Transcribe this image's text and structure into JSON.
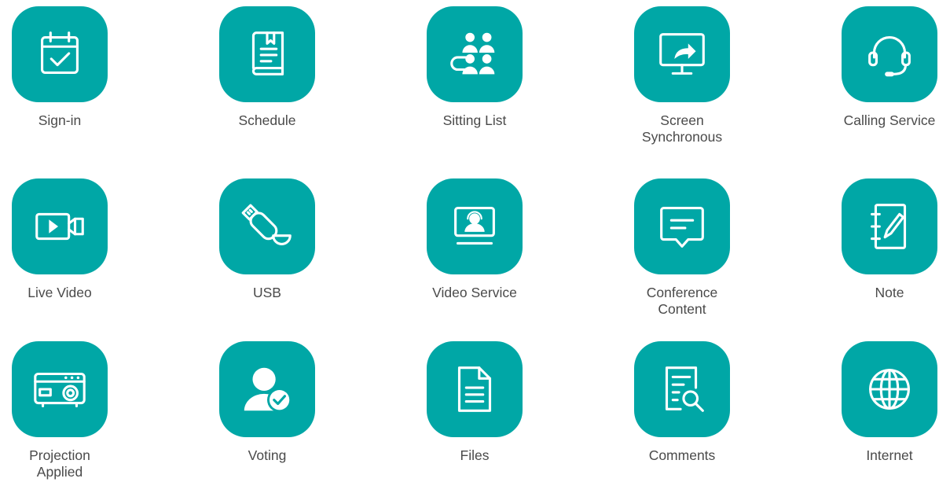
{
  "apps": [
    {
      "label": "Sign-in",
      "icon": "calendar-check-icon"
    },
    {
      "label": "Schedule",
      "icon": "book-icon"
    },
    {
      "label": "Sitting List",
      "icon": "seating-people-icon"
    },
    {
      "label_lines": [
        "Screen",
        "Synchronous"
      ],
      "icon": "monitor-share-icon"
    },
    {
      "label": "Calling Service",
      "icon": "headset-icon"
    },
    {
      "label": "Live Video",
      "icon": "video-camera-icon"
    },
    {
      "label": "USB",
      "icon": "usb-drive-icon"
    },
    {
      "label": "Video Service",
      "icon": "video-service-monitor-icon"
    },
    {
      "label_lines": [
        "Conference",
        "Content"
      ],
      "icon": "chat-bubble-icon"
    },
    {
      "label": "Note",
      "icon": "notepad-pen-icon"
    },
    {
      "label_lines": [
        "Projection",
        "Applied"
      ],
      "icon": "projector-icon"
    },
    {
      "label": "Voting",
      "icon": "user-check-icon"
    },
    {
      "label": "Files",
      "icon": "document-icon"
    },
    {
      "label": "Comments",
      "icon": "document-search-icon"
    },
    {
      "label": "Internet",
      "icon": "globe-icon"
    }
  ],
  "colors": {
    "tile": "#00a7a6",
    "label": "#4a4a4a",
    "background": "#ffffff"
  }
}
